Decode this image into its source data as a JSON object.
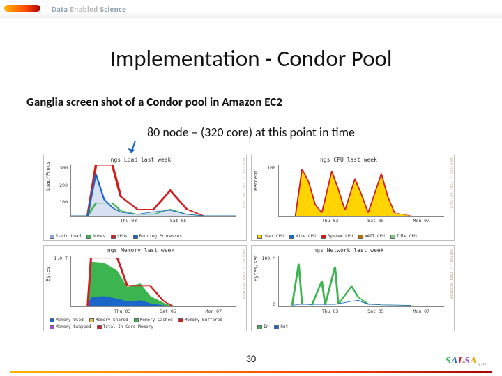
{
  "header": {
    "logo_text_a": "Data",
    "logo_text_b": "Enabled",
    "logo_text_c": "Science"
  },
  "title": "Implementation - Condor Pool",
  "subtitle1": "Ganglia screen shot of a Condor pool in Amazon EC2",
  "subtitle2": "80 node – (320 core) at this point in time",
  "rrd_watermark": "RRDTOOL / TOBI OETIKER",
  "footer": {
    "page": "30",
    "brand": "SALSA",
    "brand_sub": "HPC"
  },
  "chart_data": [
    {
      "type": "line",
      "title": "ngs Load last week",
      "ylabel": "Load/Procs",
      "xticks": [
        "",
        "Thu 03",
        "Sat 05",
        ""
      ],
      "yticks": [
        "300",
        "200",
        "100",
        ""
      ],
      "ylim": [
        0,
        320
      ],
      "series": [
        {
          "name": "1-min Load",
          "color": "#8fa8d8",
          "values": [
            0,
            0,
            280,
            120,
            60,
            30,
            10,
            30,
            40,
            10,
            0,
            0,
            0,
            0
          ]
        },
        {
          "name": "Nodes",
          "color": "#3cb450",
          "values": [
            0,
            0,
            80,
            80,
            80,
            30,
            10,
            10,
            40,
            10,
            0,
            0,
            0,
            0
          ]
        },
        {
          "name": "CPUs",
          "color": "#d41c1c",
          "values": [
            0,
            0,
            320,
            320,
            320,
            120,
            40,
            40,
            160,
            40,
            0,
            0,
            0,
            0
          ]
        },
        {
          "name": "Running Processes",
          "color": "#1b66c9",
          "values": [
            0,
            0,
            260,
            100,
            50,
            20,
            8,
            25,
            35,
            8,
            0,
            0,
            0,
            0
          ]
        }
      ]
    },
    {
      "type": "area",
      "title": "ngs CPU last week",
      "ylabel": "Percent",
      "xticks": [
        "",
        "Thu 03",
        "Sat 05",
        "Mon 07"
      ],
      "yticks": [
        "100",
        ""
      ],
      "ylim": [
        0,
        100
      ],
      "series": [
        {
          "name": "User CPU",
          "color": "#ffd400",
          "values": [
            0,
            0,
            90,
            65,
            20,
            5,
            85,
            50,
            10,
            70,
            40,
            5,
            80,
            35,
            5,
            0
          ]
        },
        {
          "name": "Nice CPU",
          "color": "#1b66c9",
          "values": [
            0,
            0,
            0,
            0,
            0,
            0,
            0,
            0,
            0,
            0,
            0,
            0,
            0,
            0,
            0,
            0
          ]
        },
        {
          "name": "System CPU",
          "color": "#d41c1c",
          "values": [
            0,
            0,
            5,
            3,
            1,
            0,
            4,
            2,
            0,
            3,
            2,
            0,
            4,
            2,
            0,
            0
          ]
        },
        {
          "name": "WAIT CPU",
          "color": "#c46e00",
          "values": [
            0,
            0,
            0,
            0,
            0,
            0,
            0,
            0,
            0,
            0,
            0,
            0,
            0,
            0,
            0,
            0
          ]
        },
        {
          "name": "Idle CPU",
          "color": "#7cc87c",
          "values": [
            100,
            100,
            5,
            32,
            79,
            95,
            11,
            48,
            90,
            27,
            58,
            95,
            16,
            63,
            95,
            100
          ]
        }
      ]
    },
    {
      "type": "area",
      "title": "ngs Memory last week",
      "ylabel": "Bytes",
      "xticks": [
        "",
        "Thu 03",
        "Sat 05",
        "Mon 07"
      ],
      "yticks": [
        "1.0 T",
        ""
      ],
      "ylim": [
        0,
        1.1
      ],
      "series": [
        {
          "name": "Memory Used",
          "color": "#1b66c9",
          "values": [
            0,
            0,
            0.18,
            0.2,
            0.15,
            0.1,
            0.12,
            0.06,
            0.02,
            0,
            0,
            0,
            0,
            0
          ]
        },
        {
          "name": "Memory Shared",
          "color": "#efc13a",
          "values": [
            0,
            0,
            0.01,
            0.01,
            0.01,
            0.0,
            0.0,
            0.0,
            0.0,
            0,
            0,
            0,
            0,
            0
          ]
        },
        {
          "name": "Memory Cached",
          "color": "#3cb450",
          "values": [
            0,
            0,
            0.8,
            0.78,
            0.6,
            0.3,
            0.4,
            0.18,
            0.06,
            0,
            0,
            0,
            0,
            0
          ]
        },
        {
          "name": "Memory Buffered",
          "color": "#d41c1c",
          "values": [
            0,
            0,
            0.02,
            0.02,
            0.02,
            0.01,
            0.01,
            0.01,
            0.0,
            0,
            0,
            0,
            0,
            0
          ]
        },
        {
          "name": "Memory Swapped",
          "color": "#a04ec4",
          "values": [
            0,
            0,
            0,
            0,
            0,
            0,
            0,
            0,
            0,
            0,
            0,
            0,
            0,
            0
          ]
        },
        {
          "name": "Total In-Core Memory",
          "color": "#d41c1c",
          "values": [
            0,
            0,
            1.05,
            1.05,
            1.05,
            0.42,
            0.42,
            0.42,
            0.1,
            0,
            0,
            0,
            0,
            0
          ]
        }
      ]
    },
    {
      "type": "line",
      "title": "ngs Network last week",
      "ylabel": "Bytes/sec",
      "xticks": [
        "",
        "Thu 03",
        "Sat 05",
        "Mon 07"
      ],
      "yticks": [
        "100 M",
        "0"
      ],
      "ylim": [
        0,
        180
      ],
      "series": [
        {
          "name": "In",
          "color": "#3cb450",
          "values": [
            0,
            0,
            150,
            8,
            5,
            2,
            90,
            5,
            3,
            140,
            6,
            2,
            70,
            30,
            8,
            3,
            0
          ]
        },
        {
          "name": "Out",
          "color": "#1b66c9",
          "values": [
            0,
            0,
            6,
            5,
            3,
            1,
            5,
            3,
            2,
            6,
            4,
            1,
            5,
            18,
            5,
            2,
            0
          ]
        }
      ]
    }
  ]
}
